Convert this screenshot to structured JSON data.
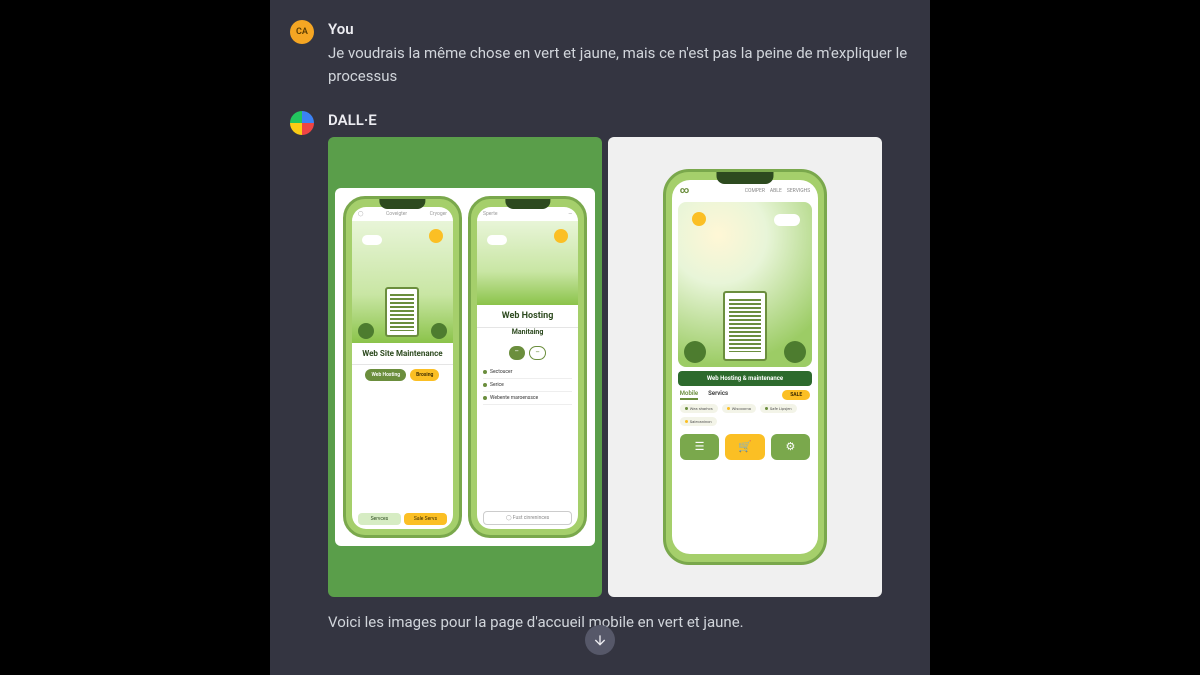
{
  "user_message": {
    "author": "You",
    "avatar_initials": "CA",
    "text": "Je voudrais la même chose en vert et jaune, mais ce n'est pas la peine de m'expliquer le processus"
  },
  "assistant_message": {
    "author": "DALL·E",
    "response_text": "Voici les images pour la page d'accueil mobile en vert et jaune."
  },
  "image1": {
    "phoneA": {
      "nav": {
        "left": "Coveigter",
        "right": "Cryoger"
      },
      "caption": "Web Site Maintenance",
      "pill1": "Web Hosting",
      "pill2": "Brosing",
      "footer1": "Servces",
      "footer2": "Sale Servs"
    },
    "phoneB": {
      "nav": {
        "left": "Sperte"
      },
      "title": "Web Hosting",
      "subtitle": "Manitaing",
      "rows": [
        "Sectoucer",
        "Serice",
        "Webente maroenssce"
      ],
      "search": "Fust cinreninces"
    }
  },
  "image2": {
    "logo": "∞",
    "nav": [
      "COMPER",
      "ABLE",
      "SERVIGHS"
    ],
    "banner": "Web Hosting & maintenance",
    "tabs": [
      "Mobile",
      "Servics"
    ],
    "chips": [
      "Wea sharhcs",
      "Wisooorna",
      "Safe Lipsjen",
      "Saiecaninon"
    ],
    "sale": "SALE"
  }
}
